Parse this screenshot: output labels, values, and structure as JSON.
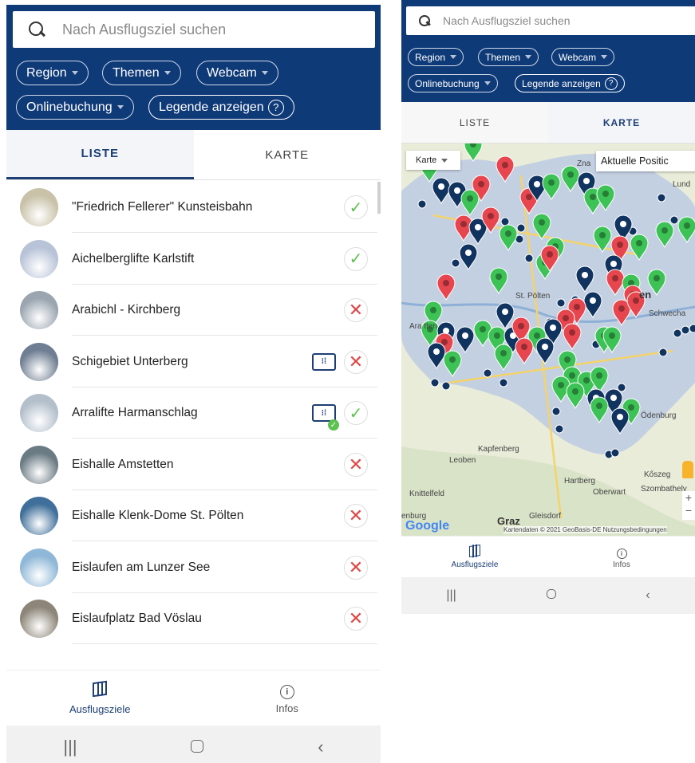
{
  "search": {
    "placeholder": "Nach Ausflugsziel suchen"
  },
  "filters": {
    "region": "Region",
    "themen": "Themen",
    "webcam": "Webcam",
    "onlinebuchung": "Onlinebuchung",
    "legende": "Legende anzeigen",
    "legende_icon": "?"
  },
  "tabs": {
    "liste": "LISTE",
    "karte": "KARTE"
  },
  "list": {
    "items": [
      {
        "label": "\"Friedrich Fellerer\" Kunsteisbahn",
        "status": "open",
        "ticket": false,
        "avatar_color": "#c9c2a8"
      },
      {
        "label": "Aichelberglifte Karlstift",
        "status": "open",
        "ticket": false,
        "avatar_color": "#b8c3d8"
      },
      {
        "label": "Arabichl - Kirchberg",
        "status": "closed",
        "ticket": false,
        "avatar_color": "#9aa5b0"
      },
      {
        "label": "Schigebiet Unterberg",
        "status": "closed",
        "ticket": true,
        "ticket_online": false,
        "avatar_color": "#6f7e92"
      },
      {
        "label": "Arralifte Harmanschlag",
        "status": "open",
        "ticket": true,
        "ticket_online": true,
        "avatar_color": "#b3bfcb"
      },
      {
        "label": "Eishalle Amstetten",
        "status": "closed",
        "ticket": false,
        "avatar_color": "#6b7b84"
      },
      {
        "label": "Eishalle Klenk-Dome St. Pölten",
        "status": "closed",
        "ticket": false,
        "avatar_color": "#3f6f9a"
      },
      {
        "label": "Eislaufen am Lunzer See",
        "status": "closed",
        "ticket": false,
        "avatar_color": "#8fb8d8"
      },
      {
        "label": "Eislaufplatz Bad Vöslau",
        "status": "closed",
        "ticket": false,
        "avatar_color": "#8c8578"
      }
    ],
    "status_open_glyph": "✓",
    "status_closed_glyph": "✕",
    "ticket_glyph": "⁝⁞"
  },
  "bottomnav": {
    "ausflugsziele": "Ausflugsziele",
    "infos": "Infos",
    "info_glyph": "i"
  },
  "sysbar": {
    "recents": "|||",
    "back": "‹"
  },
  "map": {
    "map_type": "Karte",
    "current_position": "Aktuelle Positic",
    "labels": {
      "znaim": "Zna",
      "lund": "Lund",
      "st_poelten": "St. Pölten",
      "wien": "en",
      "schwechat": "Schwecha",
      "amstetten": "Ara  tten",
      "odenburg": "Ödenburg",
      "kapfenberg": "Kapfenberg",
      "leoben": "Leoben",
      "hartberg": "Hartberg",
      "oberwart": "Oberwart",
      "koeszeg": "Kőszeg",
      "szombathely": "Szombathely",
      "knittelfeld": "Knittelfeld",
      "graz": "Graz",
      "gleisdorf": "Gleisdorf",
      "enburg": "enburg"
    },
    "google": "Google",
    "credit": "Kartendaten © 2021 GeoBasis-DE Nutzungsbedingungen",
    "zoom_in": "+",
    "zoom_out": "−",
    "colors": {
      "green": "#3cc255",
      "red": "#e8464e",
      "navy": "#10335f",
      "water": "#b7cfe8",
      "region": "#b6c6e0"
    }
  }
}
